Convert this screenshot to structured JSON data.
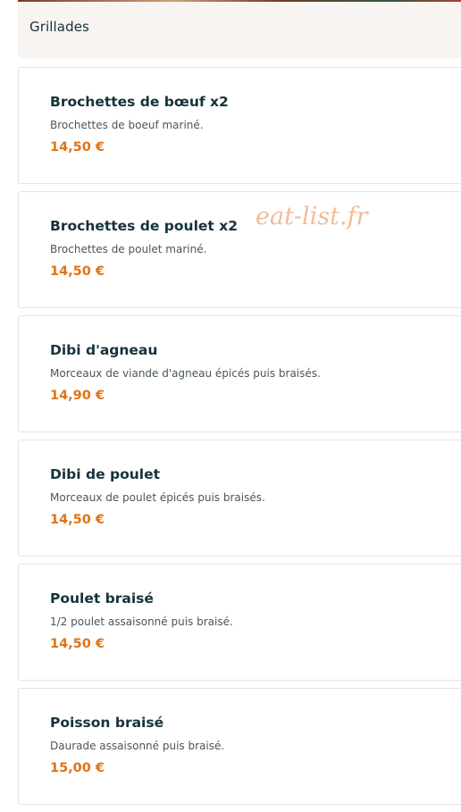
{
  "section": {
    "title": "Grillades"
  },
  "items": [
    {
      "name": "Brochettes de bœuf x2",
      "description": "Brochettes de boeuf mariné.",
      "price": "14,50 €"
    },
    {
      "name": "Brochettes de poulet x2",
      "description": "Brochettes de poulet mariné.",
      "price": "14,50 €"
    },
    {
      "name": "Dibi d'agneau",
      "description": "Morceaux de viande d'agneau épicés puis braisés.",
      "price": "14,90 €"
    },
    {
      "name": "Dibi de poulet",
      "description": "Morceaux de poulet épicés puis braisés.",
      "price": "14,50 €"
    },
    {
      "name": "Poulet braisé",
      "description": "1/2 poulet assaisonné puis braisé.",
      "price": "14,50 €"
    },
    {
      "name": "Poisson braisé",
      "description": "Daurade assaisonné puis braisé.",
      "price": "15,00 €"
    }
  ],
  "watermark": "eat-list.fr",
  "colors": {
    "price": "#e07314",
    "title": "#16323b",
    "header_bg": "#f8f4f1",
    "watermark": "#f2b48d"
  }
}
